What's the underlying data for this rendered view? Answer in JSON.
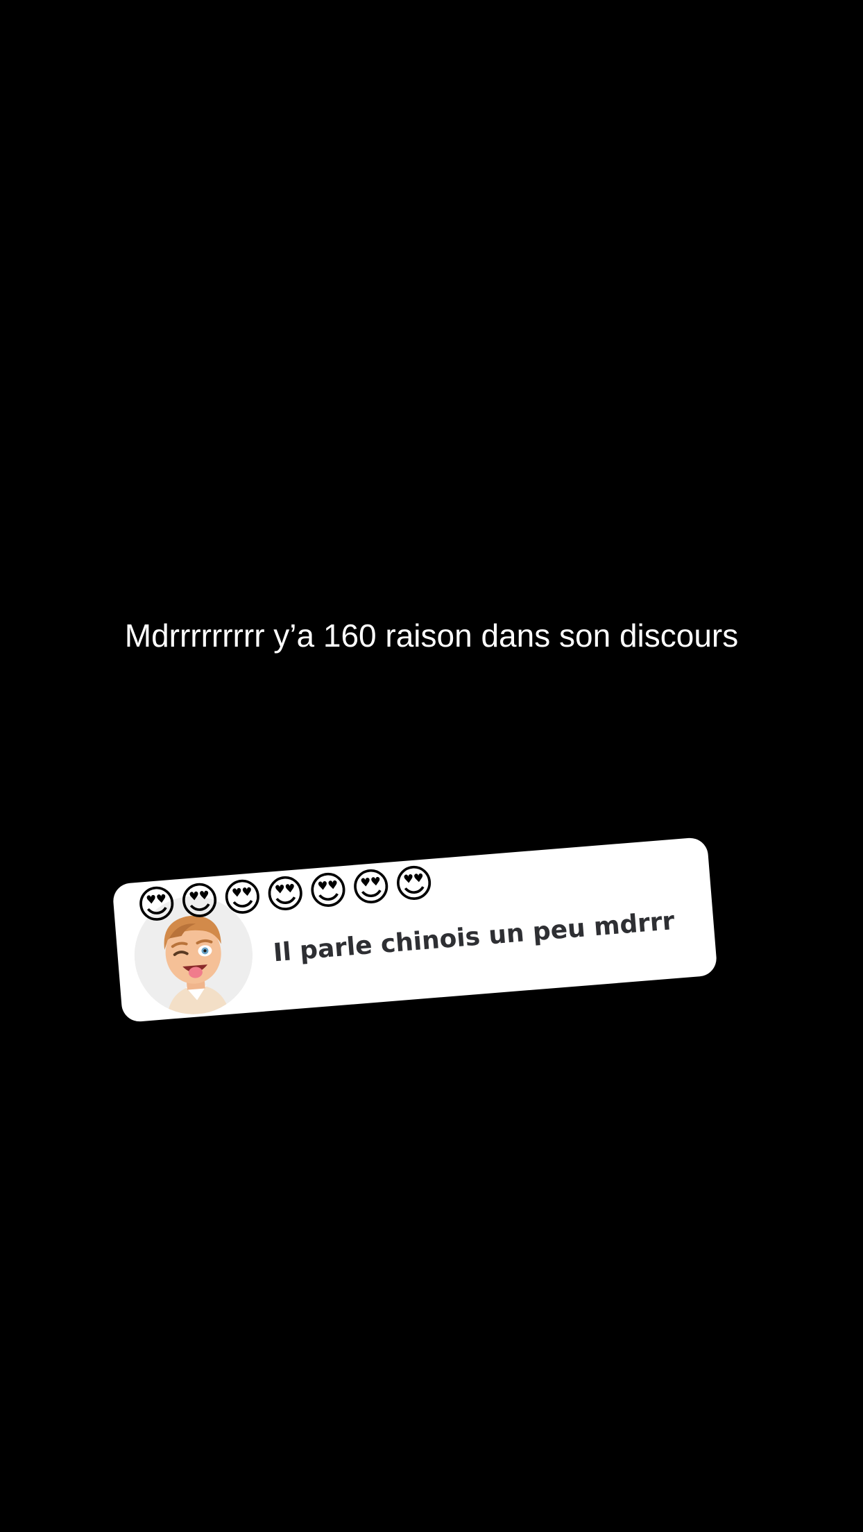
{
  "caption": {
    "text": "Mdrrrrrrrrr y’a 160 raison dans son discours"
  },
  "reply_sticker": {
    "emojis": [
      "😍",
      "😍",
      "😍",
      "😍",
      "😍",
      "😍",
      "😍"
    ],
    "text": "Il parle chinois un peu mdrrr",
    "avatar_icon": "bitmoji-winking-face-icon"
  },
  "colors": {
    "background": "#000000",
    "caption_text": "#ffffff",
    "sticker_background": "#ffffff",
    "sticker_text": "#2e2f33",
    "avatar_background": "#eeeeee"
  }
}
